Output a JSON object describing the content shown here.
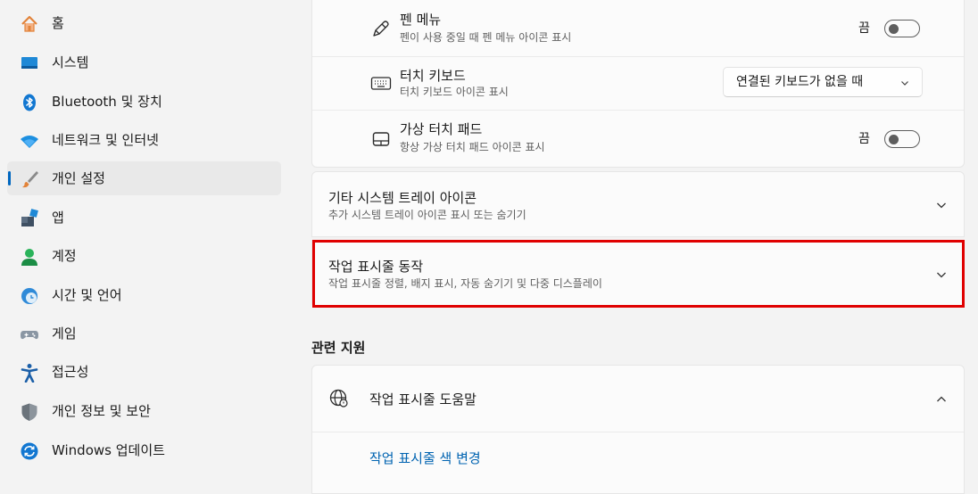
{
  "sidebar": {
    "items": [
      {
        "label": "홈",
        "icon": "home-icon"
      },
      {
        "label": "시스템",
        "icon": "system-icon"
      },
      {
        "label": "Bluetooth 및 장치",
        "icon": "bluetooth-icon"
      },
      {
        "label": "네트워크 및 인터넷",
        "icon": "wifi-icon"
      },
      {
        "label": "개인 설정",
        "icon": "brush-icon",
        "selected": true
      },
      {
        "label": "앱",
        "icon": "apps-icon"
      },
      {
        "label": "계정",
        "icon": "account-icon"
      },
      {
        "label": "시간 및 언어",
        "icon": "time-language-icon"
      },
      {
        "label": "게임",
        "icon": "gamepad-icon"
      },
      {
        "label": "접근성",
        "icon": "accessibility-icon"
      },
      {
        "label": "개인 정보 및 보안",
        "icon": "shield-icon"
      },
      {
        "label": "Windows 업데이트",
        "icon": "update-icon"
      }
    ]
  },
  "taskbar_icons": {
    "pen_menu": {
      "title": "펜 메뉴",
      "subtitle": "펜이 사용 중일 때 펜 메뉴 아이콘 표시",
      "state": "끔",
      "icon": "pen-icon"
    },
    "touch_keyboard": {
      "title": "터치 키보드",
      "subtitle": "터치 키보드 아이콘 표시",
      "dropdown_value": "연결된 키보드가 없을 때",
      "icon": "keyboard-icon"
    },
    "virtual_touchpad": {
      "title": "가상 터치 패드",
      "subtitle": "항상 가상 터치 패드 아이콘 표시",
      "state": "끔",
      "icon": "touchpad-icon"
    }
  },
  "other_tray": {
    "title": "기타 시스템 트레이 아이콘",
    "subtitle": "추가 시스템 트레이 아이콘 표시 또는 숨기기"
  },
  "taskbar_behaviors": {
    "title": "작업 표시줄 동작",
    "subtitle": "작업 표시줄 정렬, 배지 표시, 자동 숨기기 및 다중 디스플레이"
  },
  "related_support": {
    "heading": "관련 지원",
    "help_title": "작업 표시줄 도움말",
    "help_icon": "globe-icon",
    "link": "작업 표시줄 색 변경"
  },
  "colors": {
    "accent": "#0067c0",
    "highlight": "#e00000",
    "link": "#0063b1"
  }
}
